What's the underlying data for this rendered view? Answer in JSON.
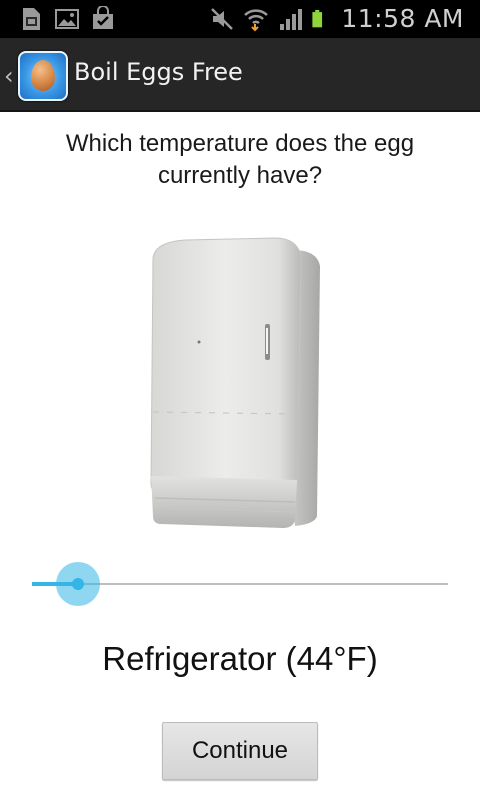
{
  "status_bar": {
    "time": "11:58 AM",
    "icons": [
      "sim-card-icon",
      "picture-icon",
      "shopping-bag-icon",
      "muted-icon",
      "wifi-icon",
      "signal-icon",
      "battery-icon"
    ],
    "battery_color": "#8ed43a"
  },
  "action_bar": {
    "title": "Boil Eggs Free",
    "back_icon": "chevron-left-icon",
    "app_icon": "egg-app-icon"
  },
  "main": {
    "question": "Which temperature does the egg currently have?",
    "image": "refrigerator-image",
    "slider": {
      "value_fraction": 0.11,
      "accent": "#33b5e5"
    },
    "temperature_label": "Refrigerator (44°F)",
    "continue_label": "Continue"
  }
}
